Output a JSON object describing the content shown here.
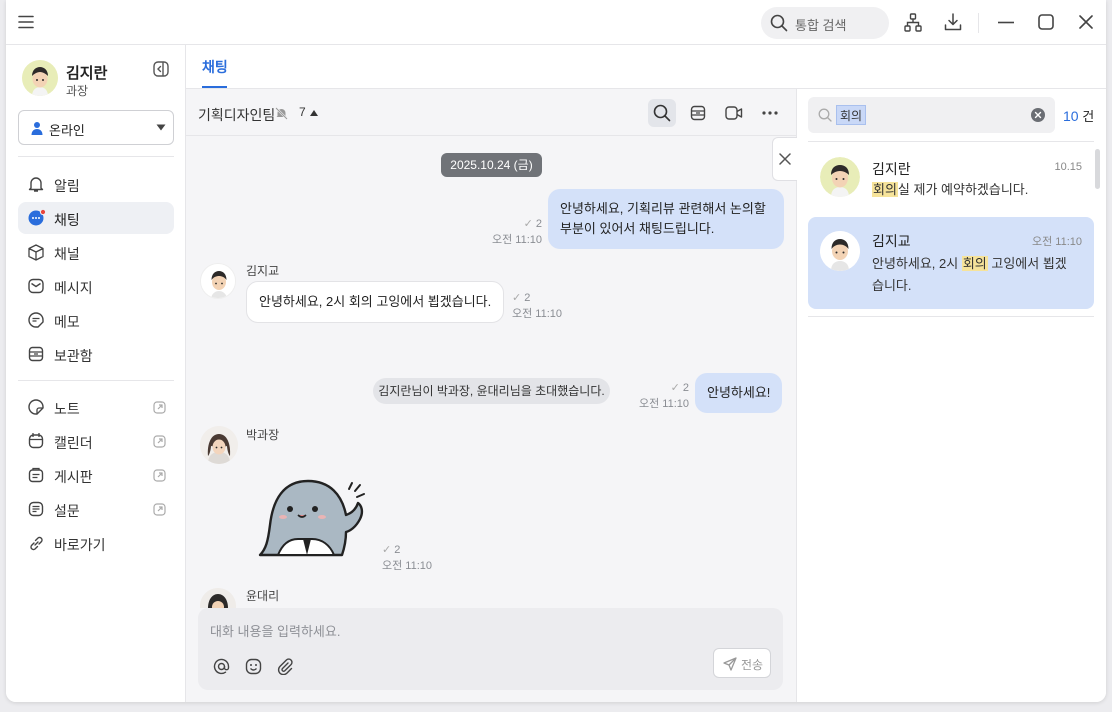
{
  "titlebar": {
    "search_placeholder": "통합 검색"
  },
  "user": {
    "name": "김지란",
    "role": "과장",
    "status": "온라인",
    "status_color": "#2a6ddc"
  },
  "nav": {
    "primary": [
      {
        "label": "알림",
        "icon": "bell-icon"
      },
      {
        "label": "채팅",
        "icon": "chat-icon",
        "active": true,
        "badge_color": "#e8453c"
      },
      {
        "label": "채널",
        "icon": "cube-icon"
      },
      {
        "label": "메시지",
        "icon": "envelope-icon"
      },
      {
        "label": "메모",
        "icon": "memo-icon"
      },
      {
        "label": "보관함",
        "icon": "archive-icon"
      }
    ],
    "secondary": [
      {
        "label": "노트",
        "icon": "note-icon",
        "external": true
      },
      {
        "label": "캘린더",
        "icon": "calendar-icon",
        "external": true
      },
      {
        "label": "게시판",
        "icon": "board-icon",
        "external": true
      },
      {
        "label": "설문",
        "icon": "survey-icon",
        "external": true
      },
      {
        "label": "바로가기",
        "icon": "link-icon",
        "external": false
      }
    ]
  },
  "tabs": [
    {
      "label": "채팅",
      "active": true
    }
  ],
  "chat": {
    "room_name": "기획디자인팀",
    "member_count": "7",
    "date_chip": "2025.10.24 (금)",
    "messages": [
      {
        "sender": "",
        "text": "안녕하세요, 기획리뷰 관련해서 논의할 부분이 있어서 채팅드립니다.",
        "read_count": "2",
        "time": "오전 11:10",
        "mine": true
      },
      {
        "sender": "김지교",
        "text": "안녕하세요, 2시 회의 고잉에서 뵙겠습니다.",
        "read_count": "2",
        "time": "오전 11:10",
        "mine": false
      },
      {
        "system": "김지란님이 박과장, 윤대리님을 초대했습니다."
      },
      {
        "sender": "",
        "text": "안녕하세요!",
        "read_count": "2",
        "time": "오전 11:10",
        "mine": true
      },
      {
        "sender": "박과장",
        "sticker": "ghost-sticker",
        "read_count": "2",
        "time": "오전 11:10",
        "mine": false
      },
      {
        "sender": "윤대리"
      }
    ],
    "composer": {
      "placeholder": "대화 내용을 입력하세요.",
      "send_label": "전송"
    }
  },
  "search_panel": {
    "query": "회의",
    "count": "10",
    "count_unit": "건",
    "results": [
      {
        "name": "김지란",
        "time": "10.15",
        "text_pre": "",
        "highlight": "회의",
        "text_post": "실 제가 예약하겠습니다.",
        "selected": false
      },
      {
        "name": "김지교",
        "time": "오전 11:10",
        "text_pre": "안녕하세요, 2시 ",
        "highlight": "회의",
        "text_post": " 고잉에서 뵙겠습니다.",
        "selected": true
      }
    ]
  },
  "colors": {
    "accent": "#2a6ddc",
    "my_bubble": "#d4e1f9",
    "highlight": "#f6e39a"
  }
}
